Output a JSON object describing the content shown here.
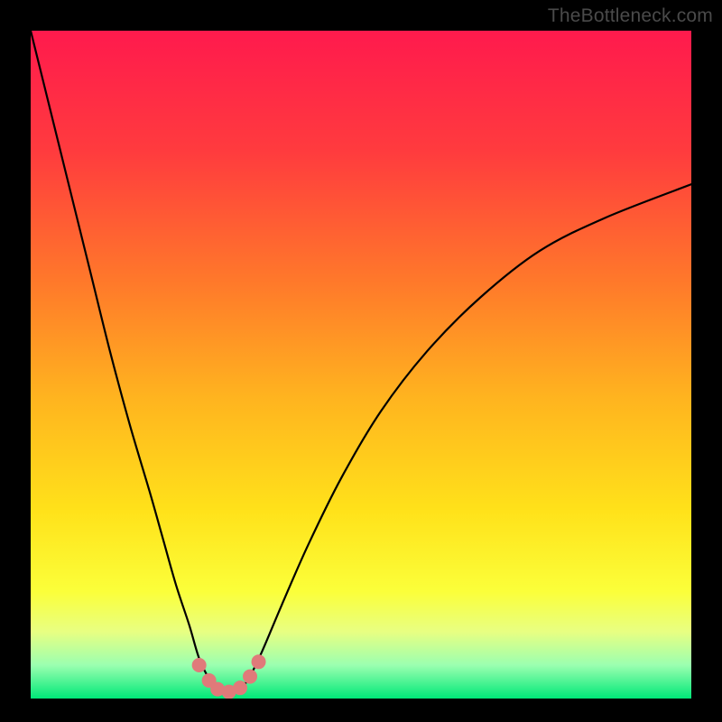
{
  "watermark": "TheBottleneck.com",
  "chart_data": {
    "type": "line",
    "title": "",
    "xlabel": "",
    "ylabel": "",
    "xlim": [
      0,
      100
    ],
    "ylim": [
      0,
      100
    ],
    "grid": false,
    "background": {
      "gradient_stops": [
        {
          "offset": 0,
          "color": "#ff1a4d"
        },
        {
          "offset": 18,
          "color": "#ff3b3e"
        },
        {
          "offset": 38,
          "color": "#ff7a2a"
        },
        {
          "offset": 55,
          "color": "#ffb41f"
        },
        {
          "offset": 72,
          "color": "#ffe21a"
        },
        {
          "offset": 84,
          "color": "#fbff3a"
        },
        {
          "offset": 90,
          "color": "#e8ff82"
        },
        {
          "offset": 95,
          "color": "#9bffb0"
        },
        {
          "offset": 100,
          "color": "#00e878"
        }
      ]
    },
    "series": [
      {
        "name": "bottleneck-curve",
        "color": "#000000",
        "x": [
          0,
          3,
          6,
          9,
          12,
          15,
          18,
          20,
          22,
          24,
          25.5,
          27,
          28.5,
          30,
          31.5,
          33,
          35,
          38,
          42,
          47,
          53,
          60,
          68,
          77,
          87,
          100
        ],
        "y": [
          100,
          88,
          76,
          64,
          52,
          41,
          31,
          24,
          17,
          11,
          6,
          3,
          1.2,
          0.8,
          1.2,
          3,
          7,
          14,
          23,
          33,
          43,
          52,
          60,
          67,
          72,
          77
        ]
      }
    ],
    "markers": {
      "name": "bottom-cluster",
      "color": "#e07a7a",
      "radius_px": 8,
      "points": [
        {
          "x": 25.5,
          "y": 5.0
        },
        {
          "x": 27.0,
          "y": 2.7
        },
        {
          "x": 28.3,
          "y": 1.4
        },
        {
          "x": 30.0,
          "y": 1.0
        },
        {
          "x": 31.7,
          "y": 1.6
        },
        {
          "x": 33.2,
          "y": 3.3
        },
        {
          "x": 34.5,
          "y": 5.5
        }
      ]
    }
  }
}
